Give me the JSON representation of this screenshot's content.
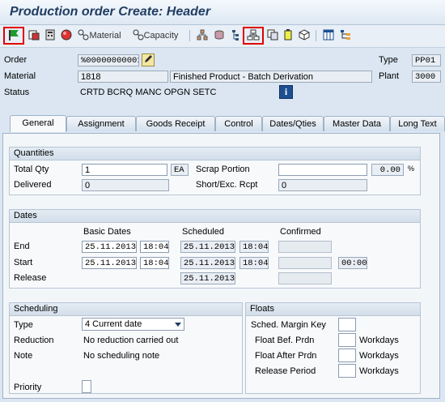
{
  "title": "Production order Create: Header",
  "toolbar": {
    "material_label": "Material",
    "capacity_label": "Capacity"
  },
  "header": {
    "order_label": "Order",
    "order_value": "%00000000001",
    "type_label": "Type",
    "type_value": "PP01",
    "material_label": "Material",
    "material_value": "1818",
    "material_desc": "Finished Product - Batch Derivation",
    "plant_label": "Plant",
    "plant_value": "3000",
    "status_label": "Status",
    "status_value": "CRTD BCRQ MANC OPGN SETC"
  },
  "tabs": [
    "General",
    "Assignment",
    "Goods Receipt",
    "Control",
    "Dates/Qties",
    "Master Data",
    "Long Text"
  ],
  "quantities": {
    "heading": "Quantities",
    "total_qty_label": "Total Qty",
    "total_qty_value": "1",
    "unit": "EA",
    "scrap_label": "Scrap Portion",
    "scrap_value": "",
    "scrap_pct": "0.00",
    "pct_sign": "%",
    "delivered_label": "Delivered",
    "delivered_value": "0",
    "short_label": "Short/Exc. Rcpt",
    "short_value": "0"
  },
  "dates": {
    "heading": "Dates",
    "basic_label": "Basic Dates",
    "scheduled_label": "Scheduled",
    "confirmed_label": "Confirmed",
    "end_label": "End",
    "start_label": "Start",
    "release_label": "Release",
    "end_basic_date": "25.11.2013",
    "end_basic_time": "18:04",
    "end_sched_date": "25.11.2013",
    "end_sched_time": "18:04",
    "start_basic_date": "25.11.2013",
    "start_basic_time": "18:04",
    "start_sched_date": "25.11.2013",
    "start_sched_time": "18:04",
    "start_conf_time": "00:00",
    "release_sched_date": "25.11.2013"
  },
  "scheduling": {
    "heading": "Scheduling",
    "type_label": "Type",
    "type_value": "4 Current date",
    "reduction_label": "Reduction",
    "reduction_value": "No reduction carried out",
    "note_label": "Note",
    "note_value": "No scheduling note",
    "priority_label": "Priority"
  },
  "floats": {
    "heading": "Floats",
    "margin_key_label": "Sched. Margin Key",
    "before_label": "Float Bef. Prdn",
    "after_label": "Float After Prdn",
    "release_label": "Release Period",
    "unit": "Workdays"
  }
}
